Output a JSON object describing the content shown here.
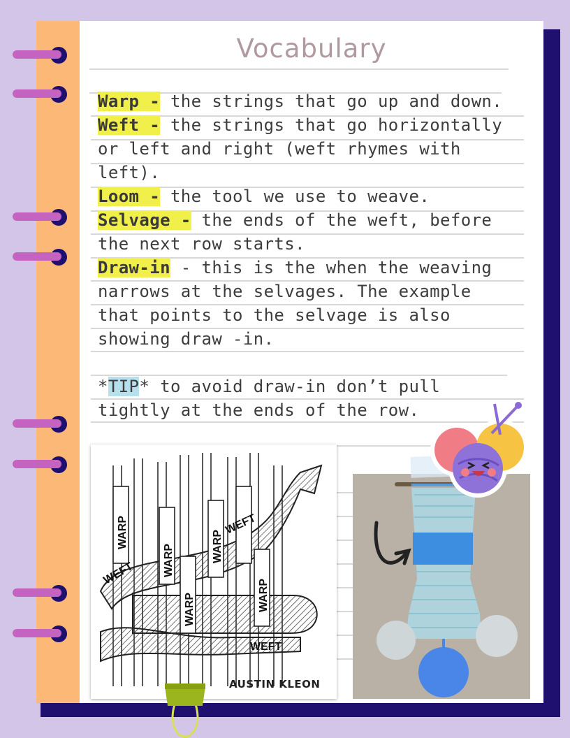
{
  "page": {
    "title": "Vocabulary"
  },
  "vocabulary": [
    {
      "term": "Warp -",
      "definition": " the strings that go up and down."
    },
    {
      "term": "Weft -",
      "definition": " the strings that go horizontally or left and right (weft rhymes with left)."
    },
    {
      "term": "Loom -",
      "definition": " the tool we use to weave."
    },
    {
      "term": "Selvage -",
      "definition": " the ends of the weft, before the next row starts."
    },
    {
      "term": "Draw-in",
      "definition": " - this is the when the weaving narrows at the selvages. The example that points to the selvage is also showing draw -in."
    }
  ],
  "tip": {
    "prefix": "*",
    "label": "TIP",
    "text": "* to avoid draw-in don’t pull tightly at the ends of the row."
  },
  "diagram": {
    "labels": {
      "warp": "WARP",
      "weft": "WEFT"
    },
    "credit": "AUSTIN KLEON"
  },
  "colors": {
    "background": "#d2c5e8",
    "spine": "#fbb877",
    "shadow": "#1f0f6e",
    "highlight": "#f1f04a",
    "tip_highlight": "#b7e0ee",
    "ring": "#c564c0",
    "title": "#b09a9f"
  },
  "icons": [
    "spiral-ring-icon",
    "yarn-ball-sticker-icon",
    "binder-clip-icon",
    "arrow-icon"
  ]
}
